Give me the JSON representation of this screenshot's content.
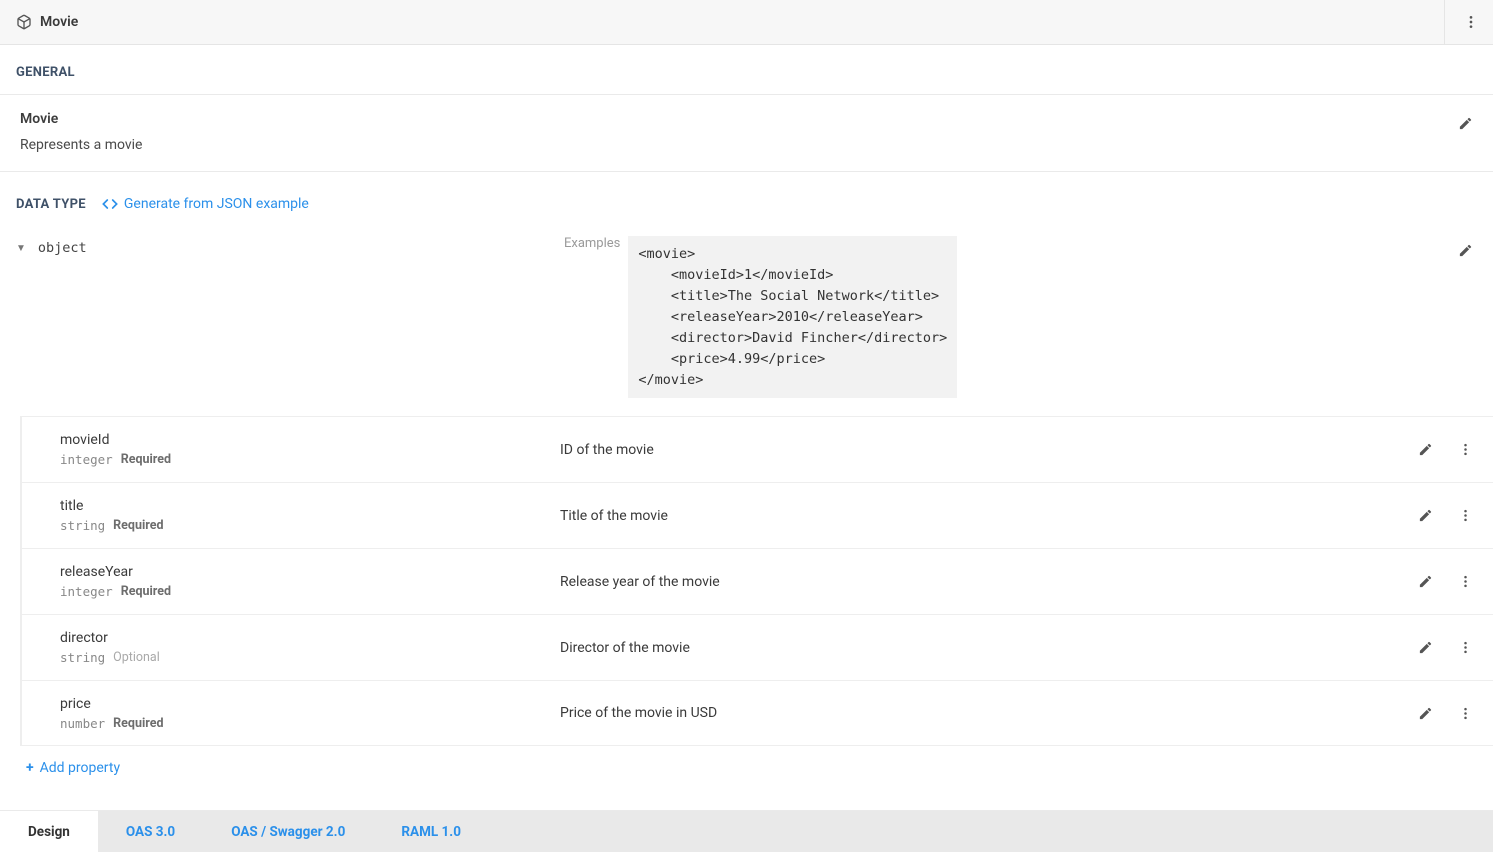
{
  "header": {
    "title": "Movie"
  },
  "sections": {
    "general_label": "GENERAL",
    "datatype_label": "DATA TYPE"
  },
  "general": {
    "title": "Movie",
    "description": "Represents a movie"
  },
  "generate_link": "Generate from JSON example",
  "object": {
    "type_label": "object",
    "examples_label": "Examples",
    "example_text": "<movie>\n    <movieId>1</movieId>\n    <title>The Social Network</title>\n    <releaseYear>2010</releaseYear>\n    <director>David Fincher</director>\n    <price>4.99</price>\n</movie>"
  },
  "properties": [
    {
      "name": "movieId",
      "type": "integer",
      "required": true,
      "required_label": "Required",
      "description": "ID of the movie"
    },
    {
      "name": "title",
      "type": "string",
      "required": true,
      "required_label": "Required",
      "description": "Title of the movie"
    },
    {
      "name": "releaseYear",
      "type": "integer",
      "required": true,
      "required_label": "Required",
      "description": "Release year of the movie"
    },
    {
      "name": "director",
      "type": "string",
      "required": false,
      "required_label": "Optional",
      "description": "Director of the movie"
    },
    {
      "name": "price",
      "type": "number",
      "required": true,
      "required_label": "Required",
      "description": "Price of the movie in USD"
    }
  ],
  "add_property_label": "Add property",
  "tabs": [
    {
      "label": "Design",
      "active": true
    },
    {
      "label": "OAS 3.0",
      "active": false
    },
    {
      "label": "OAS / Swagger 2.0",
      "active": false
    },
    {
      "label": "RAML 1.0",
      "active": false
    }
  ]
}
